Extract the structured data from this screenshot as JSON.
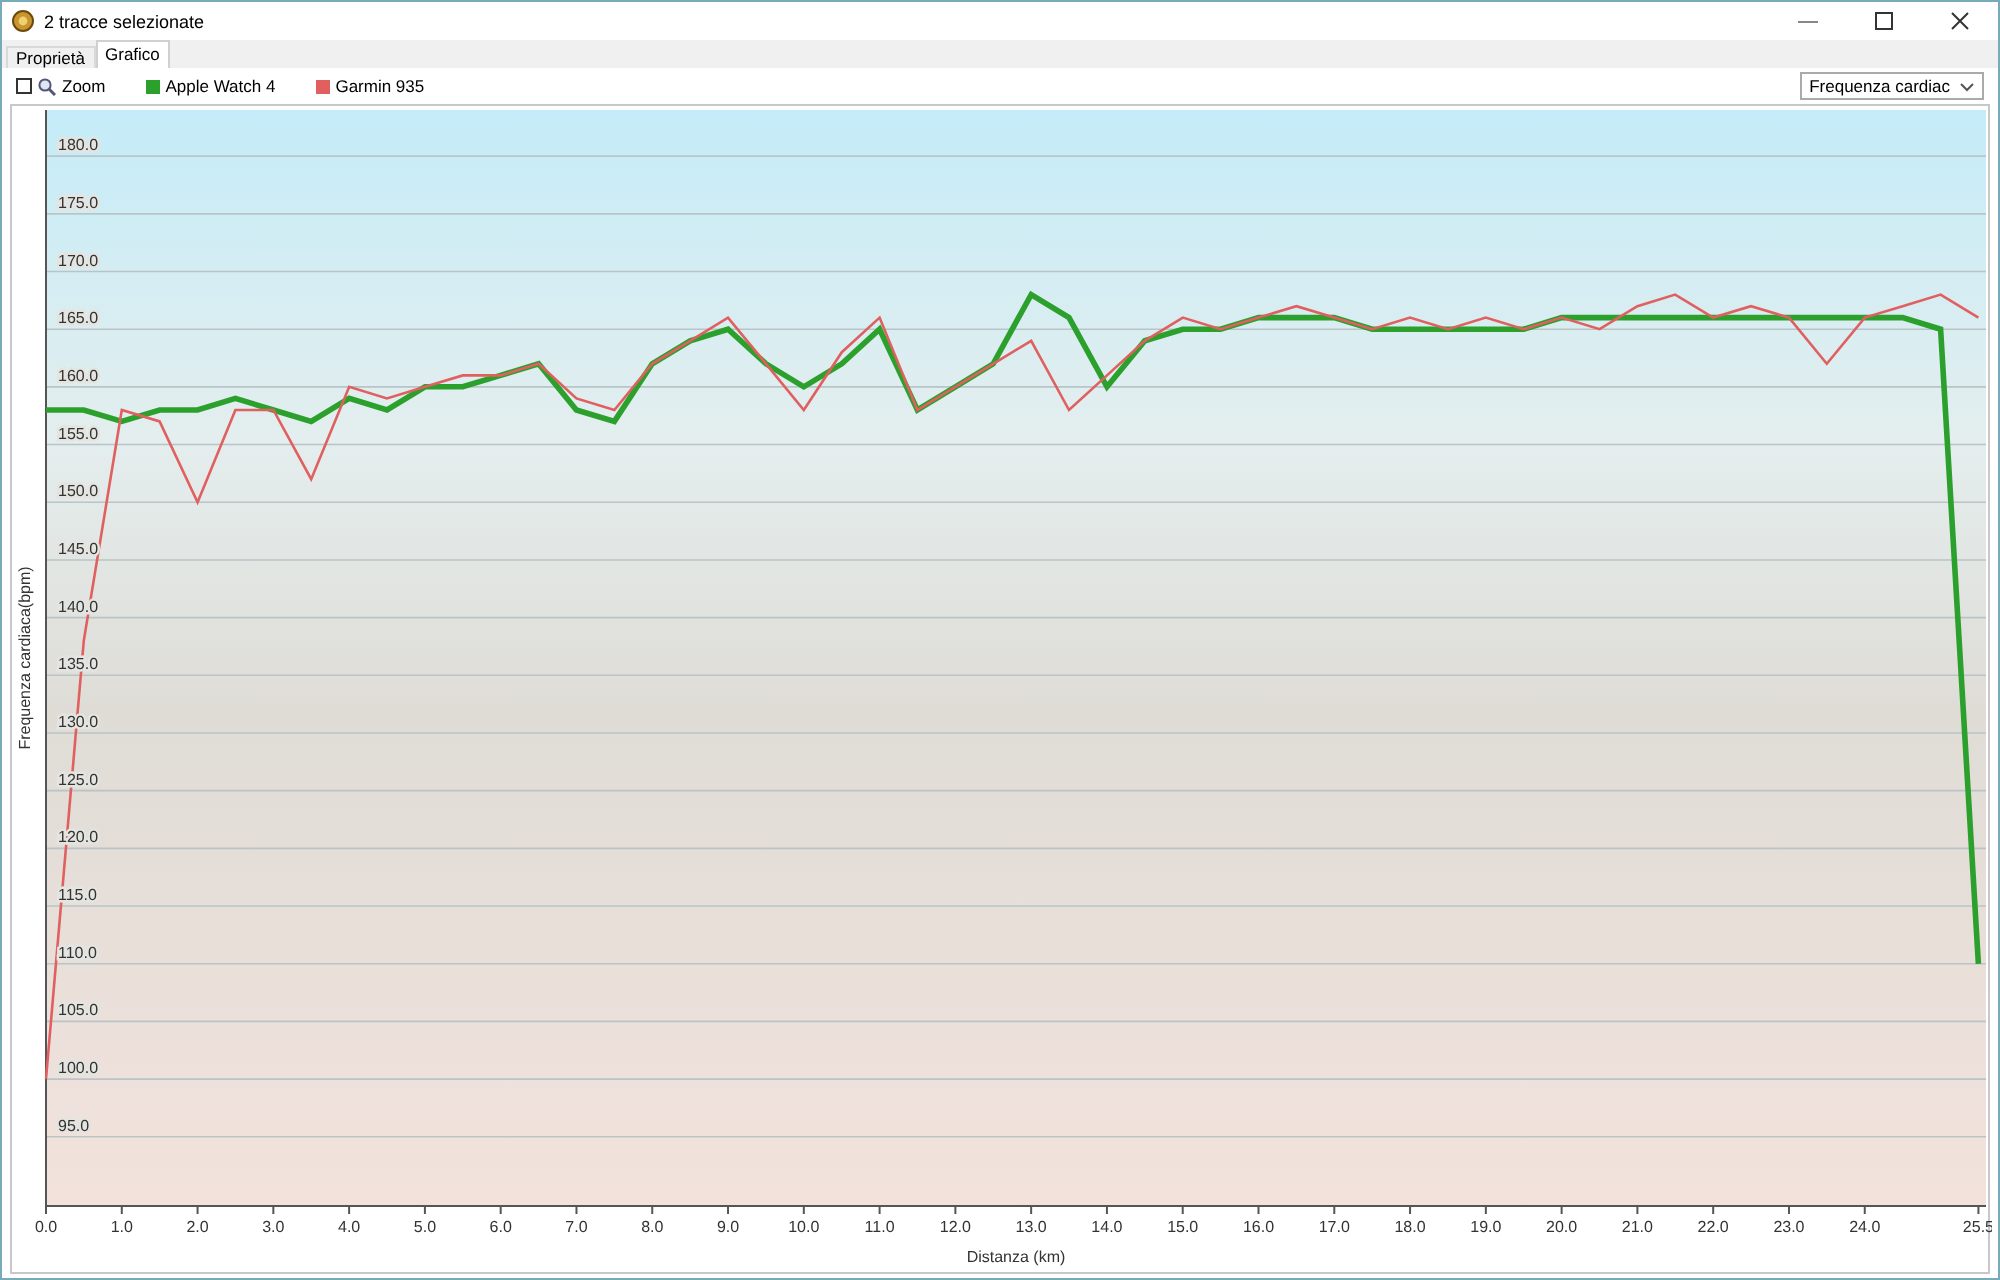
{
  "window": {
    "title": "2 tracce selezionate"
  },
  "tabs": [
    {
      "label": "Proprietà",
      "selected": false
    },
    {
      "label": "Grafico",
      "selected": true
    }
  ],
  "toolbar": {
    "zoom": {
      "label": "Zoom",
      "checked": false
    },
    "metric_dropdown": {
      "value": "Frequenza cardiac"
    }
  },
  "chart": {
    "chart_data": {
      "type": "line",
      "xlabel": "Distanza (km)",
      "ylabel": "Frequenza cardiaca(bpm)",
      "x": [
        0,
        0.5,
        1,
        1.5,
        2,
        2.5,
        3,
        3.5,
        4,
        4.5,
        5,
        5.5,
        6,
        6.5,
        7,
        7.5,
        8,
        8.5,
        9,
        9.5,
        10,
        10.5,
        11,
        11.5,
        12,
        12.5,
        13,
        13.5,
        14,
        14.5,
        15,
        15.5,
        16,
        16.5,
        17,
        17.5,
        18,
        18.5,
        19,
        19.5,
        20,
        20.5,
        21,
        21.5,
        22,
        22.5,
        23,
        23.5,
        24,
        24.5,
        25,
        25.5
      ],
      "series": [
        {
          "name": "Apple Watch 4",
          "color": "#2ca02c",
          "values": [
            158,
            158,
            157,
            158,
            158,
            159,
            158,
            157,
            159,
            158,
            160,
            160,
            161,
            162,
            158,
            157,
            162,
            164,
            165,
            162,
            160,
            162,
            165,
            158,
            160,
            162,
            168,
            166,
            160,
            164,
            165,
            165,
            166,
            166,
            166,
            165,
            165,
            165,
            165,
            165,
            166,
            166,
            166,
            166,
            166,
            166,
            166,
            166,
            166,
            166,
            165,
            110
          ]
        },
        {
          "name": "Garmin 935",
          "color": "#e06060",
          "values": [
            100,
            138,
            158,
            157,
            150,
            158,
            158,
            152,
            160,
            159,
            160,
            161,
            161,
            162,
            159,
            158,
            162,
            164,
            166,
            162,
            158,
            163,
            166,
            158,
            160,
            162,
            164,
            158,
            161,
            164,
            166,
            165,
            166,
            167,
            166,
            165,
            166,
            165,
            166,
            165,
            166,
            165,
            167,
            168,
            166,
            167,
            166,
            162,
            166,
            167,
            168,
            166
          ]
        }
      ],
      "grid": true,
      "xlim": [
        0,
        25.6
      ],
      "ylim": [
        89,
        184
      ],
      "xticks": [
        {
          "value": 0,
          "label": "0.0"
        },
        {
          "value": 1,
          "label": "1.0"
        },
        {
          "value": 2,
          "label": "2.0"
        },
        {
          "value": 3,
          "label": "3.0"
        },
        {
          "value": 4,
          "label": "4.0"
        },
        {
          "value": 5,
          "label": "5.0"
        },
        {
          "value": 6,
          "label": "6.0"
        },
        {
          "value": 7,
          "label": "7.0"
        },
        {
          "value": 8,
          "label": "8.0"
        },
        {
          "value": 9,
          "label": "9.0"
        },
        {
          "value": 10,
          "label": "10.0"
        },
        {
          "value": 11,
          "label": "11.0"
        },
        {
          "value": 12,
          "label": "12.0"
        },
        {
          "value": 13,
          "label": "13.0"
        },
        {
          "value": 14,
          "label": "14.0"
        },
        {
          "value": 15,
          "label": "15.0"
        },
        {
          "value": 16,
          "label": "16.0"
        },
        {
          "value": 17,
          "label": "17.0"
        },
        {
          "value": 18,
          "label": "18.0"
        },
        {
          "value": 19,
          "label": "19.0"
        },
        {
          "value": 20,
          "label": "20.0"
        },
        {
          "value": 21,
          "label": "21.0"
        },
        {
          "value": 22,
          "label": "22.0"
        },
        {
          "value": 23,
          "label": "23.0"
        },
        {
          "value": 24,
          "label": "24.0"
        },
        {
          "value": 25.5,
          "label": "25.5"
        }
      ],
      "yticks": [
        {
          "value": 95,
          "label": "95.0"
        },
        {
          "value": 100,
          "label": "100.0"
        },
        {
          "value": 105,
          "label": "105.0"
        },
        {
          "value": 110,
          "label": "110.0"
        },
        {
          "value": 115,
          "label": "115.0"
        },
        {
          "value": 120,
          "label": "120.0"
        },
        {
          "value": 125,
          "label": "125.0"
        },
        {
          "value": 130,
          "label": "130.0"
        },
        {
          "value": 135,
          "label": "135.0"
        },
        {
          "value": 140,
          "label": "140.0"
        },
        {
          "value": 145,
          "label": "145.0"
        },
        {
          "value": 150,
          "label": "150.0"
        },
        {
          "value": 155,
          "label": "155.0"
        },
        {
          "value": 160,
          "label": "160.0"
        },
        {
          "value": 165,
          "label": "165.0"
        },
        {
          "value": 170,
          "label": "170.0"
        },
        {
          "value": 175,
          "label": "175.0"
        },
        {
          "value": 180,
          "label": "180.0"
        }
      ]
    }
  }
}
